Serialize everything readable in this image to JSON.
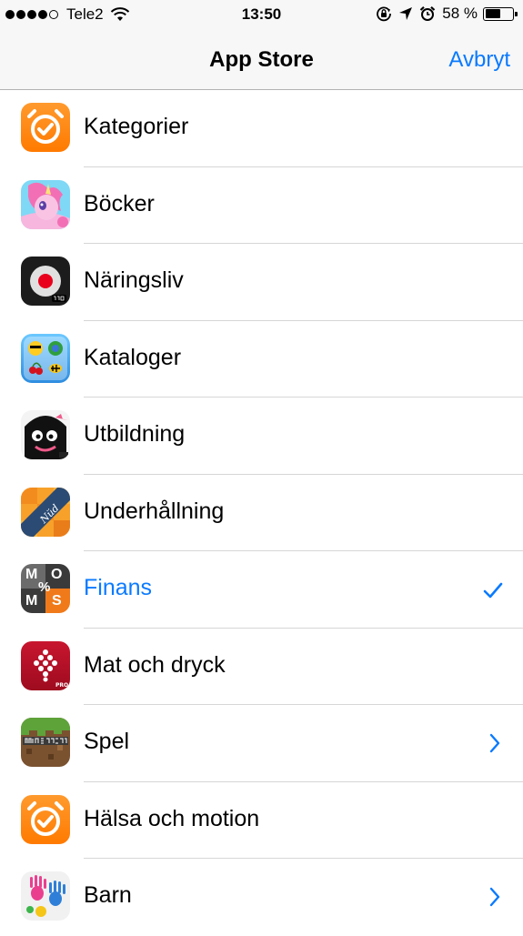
{
  "status_bar": {
    "carrier": "Tele2",
    "time": "13:50",
    "battery_percent": "58 %",
    "battery_level": 0.58,
    "signal_bars": 4
  },
  "nav": {
    "title": "App Store",
    "cancel_label": "Avbryt"
  },
  "colors": {
    "accent": "#0a7aff",
    "bar_bg": "#f7f7f7"
  },
  "rows": [
    {
      "label": "Kategorier",
      "icon": "alarm-clock-app-icon",
      "accessory": "none",
      "selected": false
    },
    {
      "label": "Böcker",
      "icon": "pony-app-icon",
      "accessory": "none",
      "selected": false
    },
    {
      "label": "Näringsliv",
      "icon": "record-pro-app-icon",
      "accessory": "none",
      "selected": false
    },
    {
      "label": "Kataloger",
      "icon": "emoji-pro-app-icon",
      "accessory": "none",
      "selected": false
    },
    {
      "label": "Utbildning",
      "icon": "toca-monster-app-icon",
      "accessory": "none",
      "selected": false
    },
    {
      "label": "Underhållning",
      "icon": "nud-app-icon",
      "accessory": "none",
      "selected": false
    },
    {
      "label": "Finans",
      "icon": "momos-calculator-app-icon",
      "icon_text": [
        "M",
        "O",
        "M",
        "S",
        "%"
      ],
      "accessory": "checkmark",
      "selected": true
    },
    {
      "label": "Mat och dryck",
      "icon": "grapes-pro-app-icon",
      "accessory": "none",
      "selected": false
    },
    {
      "label": "Spel",
      "icon": "minecraft-app-icon",
      "accessory": "chevron",
      "selected": false
    },
    {
      "label": "Hälsa och motion",
      "icon": "alarm-clock-app-icon",
      "accessory": "none",
      "selected": false
    },
    {
      "label": "Barn",
      "icon": "handprints-app-icon",
      "accessory": "chevron",
      "selected": false
    }
  ]
}
